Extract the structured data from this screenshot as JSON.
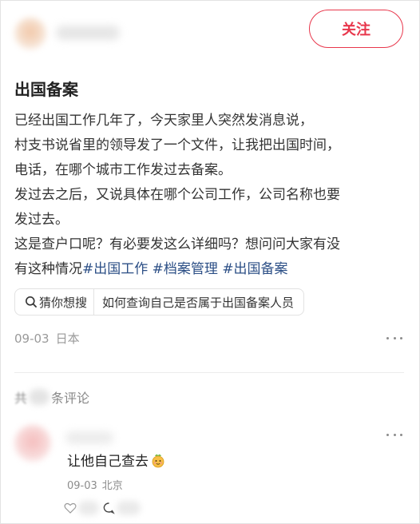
{
  "header": {
    "follow_label": "关注"
  },
  "post": {
    "title": "出国备案",
    "lines": [
      "已经出国工作几年了，今天家里人突然发消息说，",
      "村支书说省里的领导发了一个文件，让我把出国时间，",
      "电话，在哪个城市工作发过去备案。",
      "发过去之后，又说具体在哪个公司工作，公司名称也要",
      "发过去。",
      "这是查户口呢？有必要发这么详细吗？想问问大家有没"
    ],
    "last_line_text": "有这种情况",
    "tags": [
      "#出国工作",
      "#档案管理",
      "#出国备案"
    ],
    "search_chip": {
      "label": "猜你想搜",
      "query": "如何查询自己是否属于出国备案人员"
    },
    "date": "09-03",
    "location": "日本"
  },
  "comments": {
    "count_prefix": "共",
    "count_suffix": "条评论",
    "items": [
      {
        "text": "让他自己查去",
        "date": "09-03",
        "location": "北京"
      }
    ]
  },
  "colors": {
    "accent": "#e8374c",
    "tag": "#2c4f86",
    "meta": "#9a9a9a"
  },
  "icons": [
    "search-icon",
    "more-icon",
    "emoji-icon",
    "heart-icon",
    "comment-icon"
  ]
}
